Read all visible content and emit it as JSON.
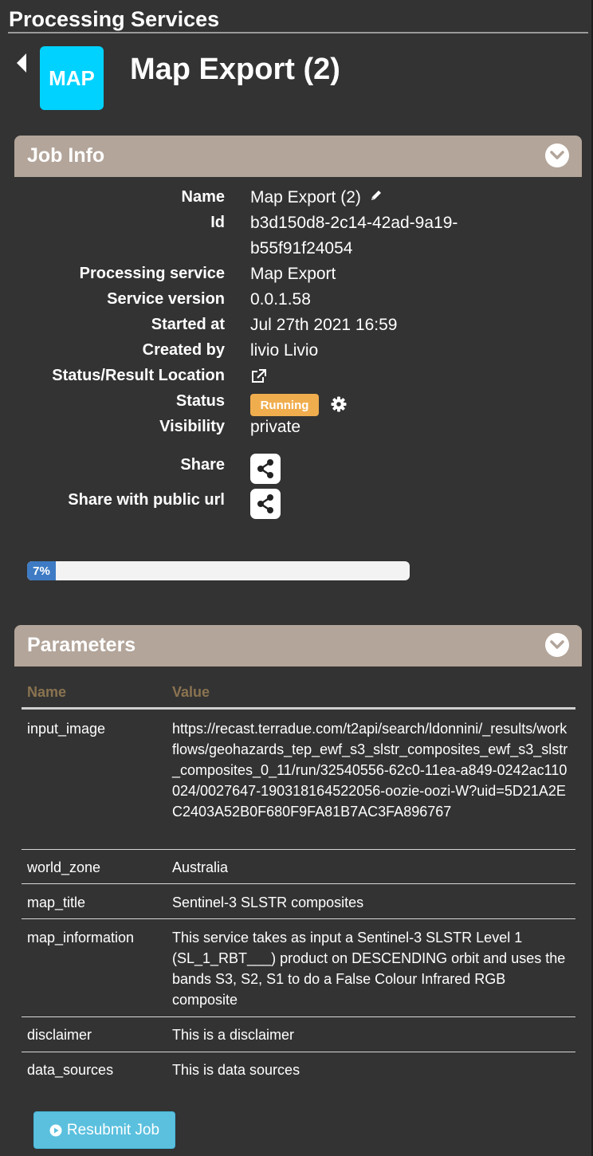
{
  "page": {
    "title": "Processing Services"
  },
  "job": {
    "logo_text": "MAP",
    "title": "Map Export (2)"
  },
  "job_info": {
    "header": "Job Info",
    "name_label": "Name",
    "name_value": "Map Export (2)",
    "id_label": "Id",
    "id_line1": "b3d150d8-2c14-42ad-9a19-",
    "id_line2": "b55f91f24054",
    "service_label": "Processing service",
    "service_value": "Map Export",
    "version_label": "Service version",
    "version_value": "0.0.1.58",
    "started_label": "Started at",
    "started_value": "Jul 27th 2021 16:59",
    "created_label": "Created by",
    "created_value": "livio Livio",
    "location_label": "Status/Result Location",
    "status_label": "Status",
    "status_value": "Running",
    "visibility_label": "Visibility",
    "visibility_value": "private",
    "share_label": "Share",
    "share_public_label": "Share with public url"
  },
  "progress": {
    "percent": 7,
    "label": "7%"
  },
  "parameters": {
    "header": "Parameters",
    "col_name": "Name",
    "col_value": "Value",
    "rows": [
      {
        "name": "input_image",
        "value": "https://recast.terradue.com/t2api/search/ldonnini/_results/workflows/geohazards_tep_ewf_s3_slstr_composites_ewf_s3_slstr_composites_0_11/run/32540556-62c0-11ea-a849-0242ac110024/0027647-190318164522056-oozie-oozi-W?uid=5D21A2EC2403A52B0F680F9FA81B7AC3FA896767"
      },
      {
        "name": "world_zone",
        "value": "Australia"
      },
      {
        "name": "map_title",
        "value": "Sentinel-3 SLSTR composites"
      },
      {
        "name": "map_information",
        "value": "This service takes as input a Sentinel-3 SLSTR Level 1 (SL_1_RBT___) product on DESCENDING orbit and uses the bands S3, S2, S1 to do a False Colour Infrared RGB composite"
      },
      {
        "name": "disclaimer",
        "value": "This is a disclaimer"
      },
      {
        "name": "data_sources",
        "value": "This is data sources"
      }
    ]
  },
  "actions": {
    "resubmit_label": "Resubmit Job"
  }
}
